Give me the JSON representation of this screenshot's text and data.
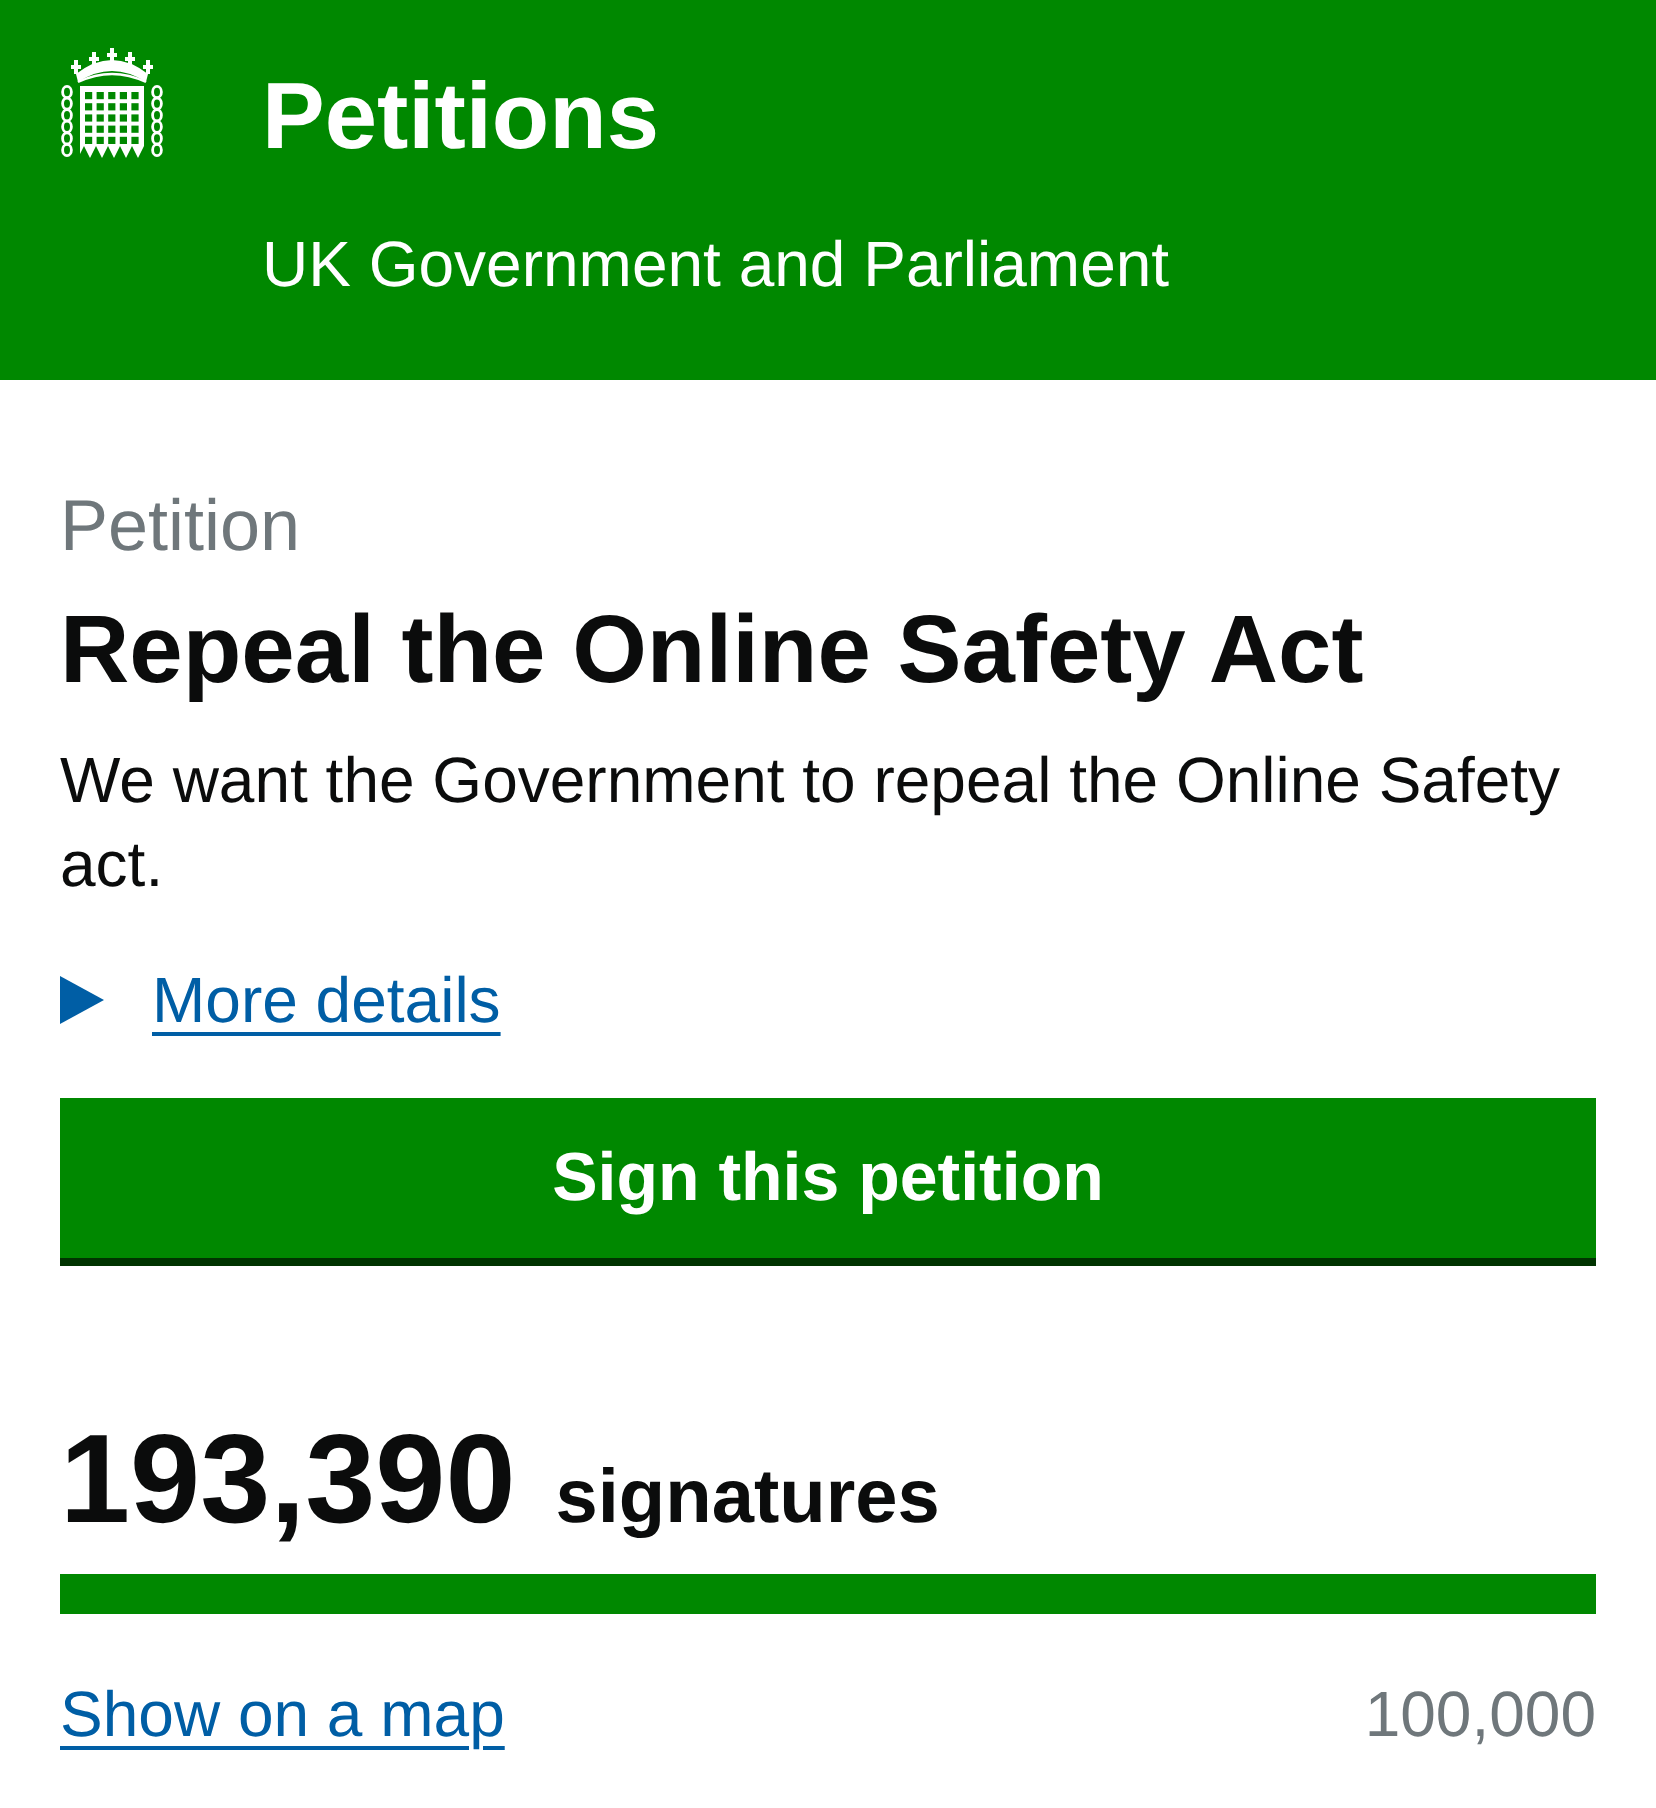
{
  "header": {
    "title": "Petitions",
    "subtitle": "UK Government and Parliament"
  },
  "petition": {
    "label": "Petition",
    "title": "Repeal the Online Safety Act",
    "description": "We want the Government to repeal the Online Safety act.",
    "details_link": {
      "label": "More details",
      "expanded": false
    }
  },
  "sign_button": {
    "label": "Sign this petition"
  },
  "signatures": {
    "count": "193,390",
    "unit": "signatures",
    "progress": {
      "level": 1
    },
    "map_link": "Show on a map",
    "threshold": "100,000"
  }
}
